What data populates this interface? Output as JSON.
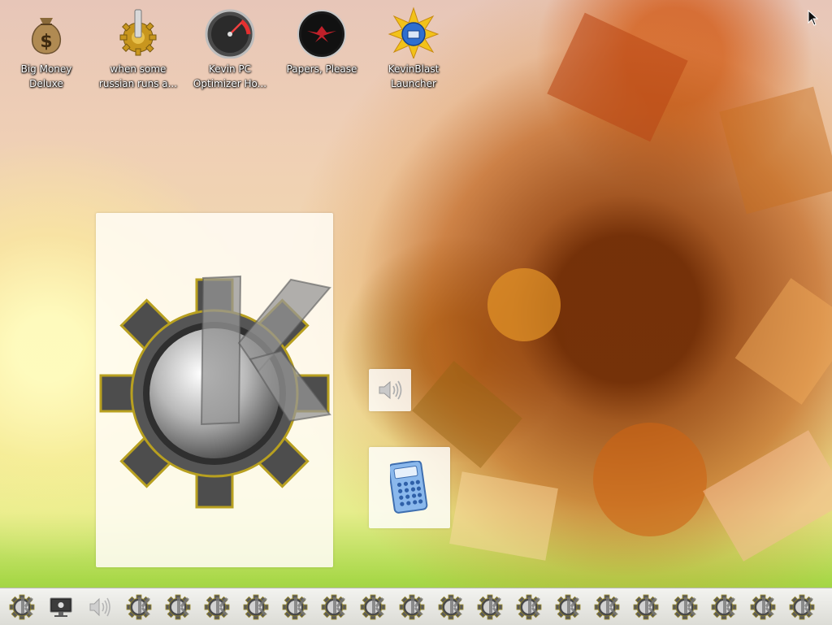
{
  "desktop": {
    "icons": [
      {
        "label": "Big Money Deluxe",
        "icon": "money-bag-icon"
      },
      {
        "label": "when some russian runs a...",
        "icon": "gear-icon"
      },
      {
        "label": "Kevin PC Optimizer Ho...",
        "icon": "speedometer-icon"
      },
      {
        "label": "Papers, Please",
        "icon": "eagle-emblem-icon"
      },
      {
        "label": "KevinBlast Launcher",
        "icon": "starburst-disc-icon"
      }
    ],
    "widgets": [
      {
        "name": "kde-logo-card",
        "icon": "kde-gear-logo-icon"
      },
      {
        "name": "volume-tile",
        "icon": "speaker-icon"
      },
      {
        "name": "calculator-tile",
        "icon": "calculator-icon"
      }
    ]
  },
  "taskbar": {
    "items": [
      {
        "icon": "kde-launcher-icon"
      },
      {
        "icon": "monitor-icon"
      },
      {
        "icon": "speaker-icon"
      },
      {
        "icon": "kde-launcher-icon"
      },
      {
        "icon": "kde-launcher-icon"
      },
      {
        "icon": "kde-launcher-icon"
      },
      {
        "icon": "kde-launcher-icon"
      },
      {
        "icon": "kde-launcher-icon"
      },
      {
        "icon": "kde-launcher-icon"
      },
      {
        "icon": "kde-launcher-icon"
      },
      {
        "icon": "kde-launcher-icon"
      },
      {
        "icon": "kde-launcher-icon"
      },
      {
        "icon": "kde-launcher-icon"
      },
      {
        "icon": "kde-launcher-icon"
      },
      {
        "icon": "kde-launcher-icon"
      },
      {
        "icon": "kde-launcher-icon"
      },
      {
        "icon": "kde-launcher-icon"
      },
      {
        "icon": "kde-launcher-icon"
      },
      {
        "icon": "kde-launcher-icon"
      },
      {
        "icon": "kde-launcher-icon"
      },
      {
        "icon": "kde-launcher-icon"
      }
    ]
  }
}
